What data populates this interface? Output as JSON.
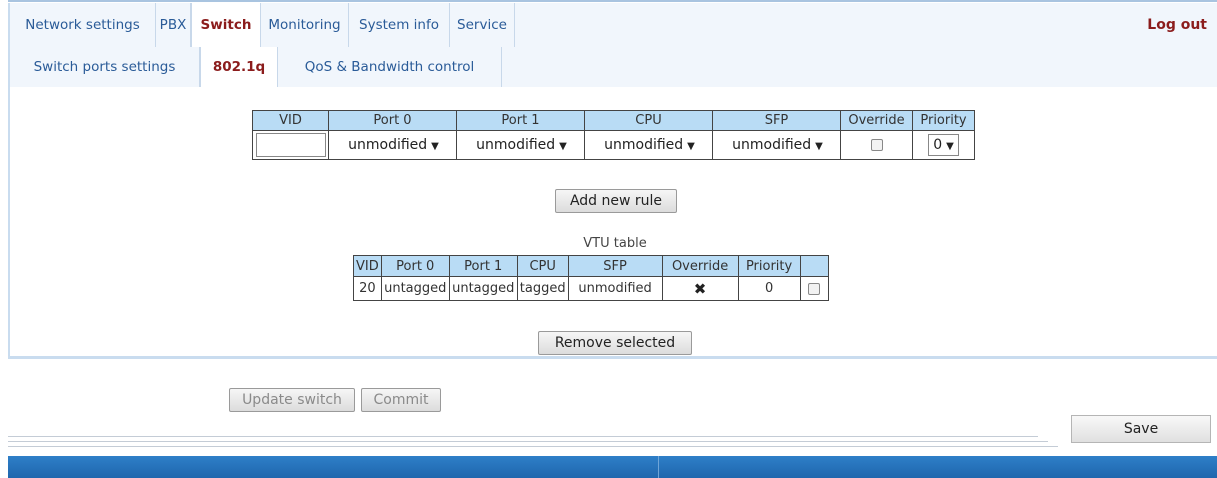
{
  "nav": {
    "tabs": [
      "Network settings",
      "PBX",
      "Switch",
      "Monitoring",
      "System info",
      "Service"
    ],
    "active": "Switch",
    "logout": "Log out"
  },
  "subnav": {
    "tabs": [
      "Switch ports settings",
      "802.1q",
      "QoS & Bandwidth control"
    ],
    "active": "802.1q"
  },
  "rule_form": {
    "headers": [
      "VID",
      "Port 0",
      "Port 1",
      "CPU",
      "SFP",
      "Override",
      "Priority"
    ],
    "vid_value": "",
    "port0": "unmodified",
    "port1": "unmodified",
    "cpu": "unmodified",
    "sfp": "unmodified",
    "override_checked": false,
    "priority": "0",
    "add_button": "Add new rule"
  },
  "vtu_table": {
    "title": "VTU table",
    "headers": [
      "VID",
      "Port 0",
      "Port 1",
      "CPU",
      "SFP",
      "Override",
      "Priority",
      ""
    ],
    "rows": [
      {
        "vid": "20",
        "port0": "untagged",
        "port1": "untagged",
        "cpu": "tagged",
        "sfp": "unmodified",
        "override": "✖",
        "priority": "0",
        "selected": false
      }
    ],
    "remove_button": "Remove selected"
  },
  "actions": {
    "update_switch": "Update switch",
    "commit": "Commit",
    "save": "Save"
  },
  "colors": {
    "accent_red": "#8b1c1c",
    "link_blue": "#2a5b98",
    "header_bg": "#b9dcf5",
    "footer_blue": "#2e7fc8"
  }
}
